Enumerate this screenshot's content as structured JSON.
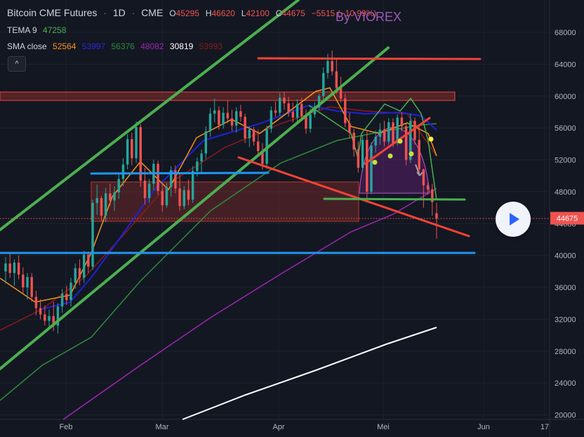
{
  "header": {
    "symbol": "Bitcoin CME Futures",
    "interval": "1D",
    "exchange": "CME",
    "o_label": "O",
    "o_value": "45295",
    "h_label": "H",
    "h_value": "46620",
    "l_label": "L",
    "l_value": "42100",
    "c_label": "C",
    "c_value": "44675",
    "change": "−5515 (−10.99%)"
  },
  "indicators": {
    "tema": {
      "label": "TEMA 9",
      "value": "47258"
    },
    "sma": {
      "label": "SMA close",
      "values": [
        "52564",
        "53997",
        "56376",
        "48082",
        "30819",
        "53993"
      ]
    }
  },
  "collapse_label": "^",
  "watermark": "By VIOREX",
  "price_label": "44675",
  "colors": {
    "background": "#131722",
    "up": "#26a69a",
    "down": "#ef5350",
    "tema": "#f7931a",
    "sma_colors": [
      "#f7931a",
      "#1e22d6",
      "#2e8b3a",
      "#9c27b0",
      "#ffffff",
      "#8b1a1a"
    ],
    "channel": "#4caf50",
    "support": "#2196f3",
    "resistance": "#f44336",
    "price_label_bg": "#ef5350"
  },
  "chart_data": {
    "type": "candlestick",
    "y_ticks": [
      20000,
      24000,
      28000,
      32000,
      36000,
      40000,
      44000,
      48000,
      52000,
      56000,
      60000,
      64000,
      68000
    ],
    "x_ticks": [
      "Feb",
      "Mar",
      "Apr",
      "Mei",
      "Jun",
      "17"
    ],
    "ylim": [
      19500,
      70000
    ],
    "last_close": 44675,
    "candles": [
      [
        38000,
        39800,
        36500,
        39000
      ],
      [
        39000,
        40200,
        37200,
        37800
      ],
      [
        37800,
        39500,
        36200,
        39100
      ],
      [
        39100,
        40000,
        37000,
        37600
      ],
      [
        37600,
        38500,
        35300,
        36000
      ],
      [
        36000,
        37800,
        34500,
        37300
      ],
      [
        37300,
        37800,
        34200,
        34800
      ],
      [
        34800,
        35600,
        32500,
        33400
      ],
      [
        33400,
        34500,
        32000,
        32600
      ],
      [
        32600,
        33700,
        31200,
        31800
      ],
      [
        31800,
        33200,
        30800,
        32400
      ],
      [
        32400,
        34200,
        30500,
        31200
      ],
      [
        31200,
        34000,
        30200,
        33600
      ],
      [
        33600,
        35800,
        32800,
        35200
      ],
      [
        35200,
        36200,
        33800,
        34400
      ],
      [
        34400,
        37200,
        33600,
        36600
      ],
      [
        36600,
        39000,
        35800,
        38400
      ],
      [
        38400,
        39500,
        36300,
        37200
      ],
      [
        37200,
        40600,
        36600,
        40100
      ],
      [
        40100,
        40500,
        37800,
        38600
      ],
      [
        38600,
        47000,
        38200,
        46600
      ],
      [
        46600,
        48900,
        45100,
        47200
      ],
      [
        47200,
        47500,
        44300,
        45000
      ],
      [
        45000,
        48500,
        44200,
        47800
      ],
      [
        47800,
        49000,
        46200,
        46900
      ],
      [
        46900,
        48700,
        45600,
        47900
      ],
      [
        47900,
        50400,
        47100,
        49600
      ],
      [
        49600,
        52200,
        48700,
        51400
      ],
      [
        51400,
        55200,
        50800,
        54600
      ],
      [
        54600,
        55400,
        51300,
        52200
      ],
      [
        52200,
        56800,
        51600,
        56100
      ],
      [
        56100,
        56500,
        48600,
        49400
      ],
      [
        49400,
        51000,
        46400,
        47200
      ],
      [
        47200,
        49600,
        46600,
        49000
      ],
      [
        49000,
        52000,
        48200,
        51500
      ],
      [
        51500,
        51900,
        47600,
        48100
      ],
      [
        48100,
        49200,
        45500,
        46300
      ],
      [
        46300,
        49100,
        46000,
        48600
      ],
      [
        48600,
        51200,
        47400,
        50700
      ],
      [
        50700,
        51300,
        47800,
        48400
      ],
      [
        48400,
        50300,
        45600,
        46200
      ],
      [
        46200,
        48700,
        45800,
        48200
      ],
      [
        48200,
        49500,
        46300,
        47000
      ],
      [
        47000,
        51200,
        46600,
        50600
      ],
      [
        50600,
        52300,
        49900,
        51800
      ],
      [
        51800,
        53300,
        50400,
        52800
      ],
      [
        52800,
        56200,
        52100,
        55600
      ],
      [
        55600,
        58500,
        54900,
        57800
      ],
      [
        57800,
        59700,
        56700,
        58200
      ],
      [
        58200,
        58700,
        55800,
        56400
      ],
      [
        56400,
        58600,
        55900,
        57900
      ],
      [
        57900,
        59400,
        56600,
        57200
      ],
      [
        57200,
        58300,
        55600,
        56300
      ],
      [
        56300,
        58600,
        55400,
        58100
      ],
      [
        58100,
        58900,
        56800,
        57400
      ],
      [
        57400,
        57800,
        54100,
        54700
      ],
      [
        54700,
        56200,
        53600,
        55800
      ],
      [
        55800,
        56100,
        53800,
        54300
      ],
      [
        54300,
        55800,
        52700,
        53100
      ],
      [
        53100,
        54100,
        50800,
        51500
      ],
      [
        51500,
        56300,
        50900,
        55900
      ],
      [
        55900,
        58700,
        55400,
        58200
      ],
      [
        58200,
        59300,
        57400,
        57900
      ],
      [
        57900,
        60400,
        57500,
        59800
      ],
      [
        59800,
        60500,
        58300,
        59100
      ],
      [
        59100,
        59900,
        57400,
        58000
      ],
      [
        58000,
        59200,
        56700,
        57300
      ],
      [
        57300,
        59600,
        56800,
        59000
      ],
      [
        59000,
        59800,
        57100,
        57500
      ],
      [
        57500,
        58300,
        55300,
        55900
      ],
      [
        55900,
        58400,
        55400,
        57700
      ],
      [
        57700,
        59200,
        57300,
        58600
      ],
      [
        58600,
        60300,
        58200,
        60000
      ],
      [
        60000,
        63600,
        59600,
        62900
      ],
      [
        62900,
        65300,
        62200,
        64400
      ],
      [
        64400,
        65700,
        62600,
        63100
      ],
      [
        63100,
        64600,
        60300,
        61000
      ],
      [
        61000,
        62400,
        59200,
        59700
      ],
      [
        59700,
        60300,
        56100,
        56600
      ],
      [
        56600,
        57900,
        54700,
        55400
      ],
      [
        55400,
        55900,
        52400,
        53300
      ],
      [
        53300,
        54300,
        50400,
        51000
      ],
      [
        51000,
        55100,
        50600,
        54500
      ],
      [
        54500,
        55600,
        47200,
        48000
      ],
      [
        48000,
        54200,
        47700,
        53800
      ],
      [
        53800,
        55700,
        52900,
        54900
      ],
      [
        54900,
        56600,
        53900,
        55800
      ],
      [
        55800,
        56900,
        53700,
        54300
      ],
      [
        54300,
        57200,
        53900,
        56700
      ],
      [
        56700,
        57200,
        53600,
        54100
      ],
      [
        54100,
        57700,
        53800,
        57300
      ],
      [
        57300,
        58000,
        55600,
        56200
      ],
      [
        56200,
        56600,
        51300,
        52000
      ],
      [
        52000,
        57800,
        51600,
        56900
      ],
      [
        56900,
        57300,
        53900,
        54500
      ],
      [
        54500,
        56500,
        50000,
        50800
      ],
      [
        50800,
        50900,
        46000,
        48800
      ],
      [
        48800,
        49200,
        47600,
        48300
      ],
      [
        48300,
        49000,
        45000,
        46700
      ],
      [
        45295,
        46620,
        42100,
        44675
      ]
    ],
    "levels": {
      "resistance_top": 63900,
      "support_bottom": 40200,
      "neckline": 47000,
      "upper_support": 50400
    }
  }
}
